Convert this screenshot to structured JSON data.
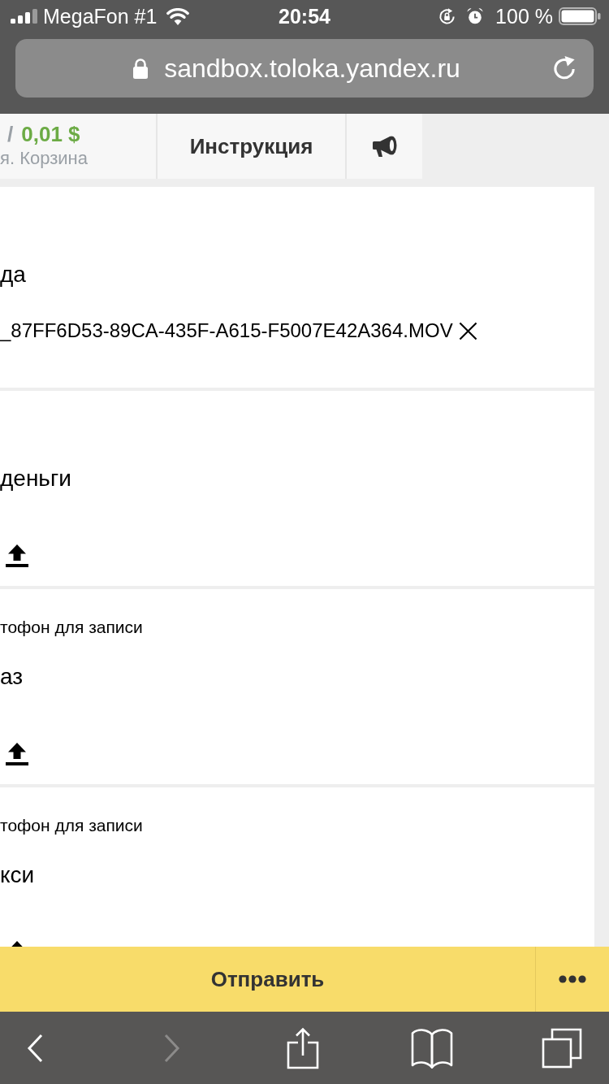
{
  "status_bar": {
    "carrier": "MegaFon #1",
    "time": "20:54",
    "battery": "100 %"
  },
  "address_bar": {
    "url": "sandbox.toloka.yandex.ru"
  },
  "task_toolbar": {
    "separator": "/",
    "reward": "0,01 $",
    "pool_name": "я. Корзина",
    "instruction_tab": "Инструкция"
  },
  "questions": [
    {
      "kind": "file",
      "title": "да",
      "file_name": "_87FF6D53-89CA-435F-A615-F5007E42A364.MOV"
    },
    {
      "kind": "upload",
      "title": "деньги"
    },
    {
      "kind": "upload",
      "hint": "тофон для записи",
      "title": "аз"
    },
    {
      "kind": "upload",
      "hint": "тофон для записи",
      "title": "кси"
    }
  ],
  "action_bar": {
    "submit": "Отправить"
  },
  "browser_toolbar": [
    {
      "kind": "back",
      "disabled": false
    },
    {
      "kind": "forward",
      "disabled": true
    },
    {
      "kind": "share",
      "disabled": false
    },
    {
      "kind": "bookmarks",
      "disabled": false
    },
    {
      "kind": "tabs",
      "disabled": false
    }
  ]
}
